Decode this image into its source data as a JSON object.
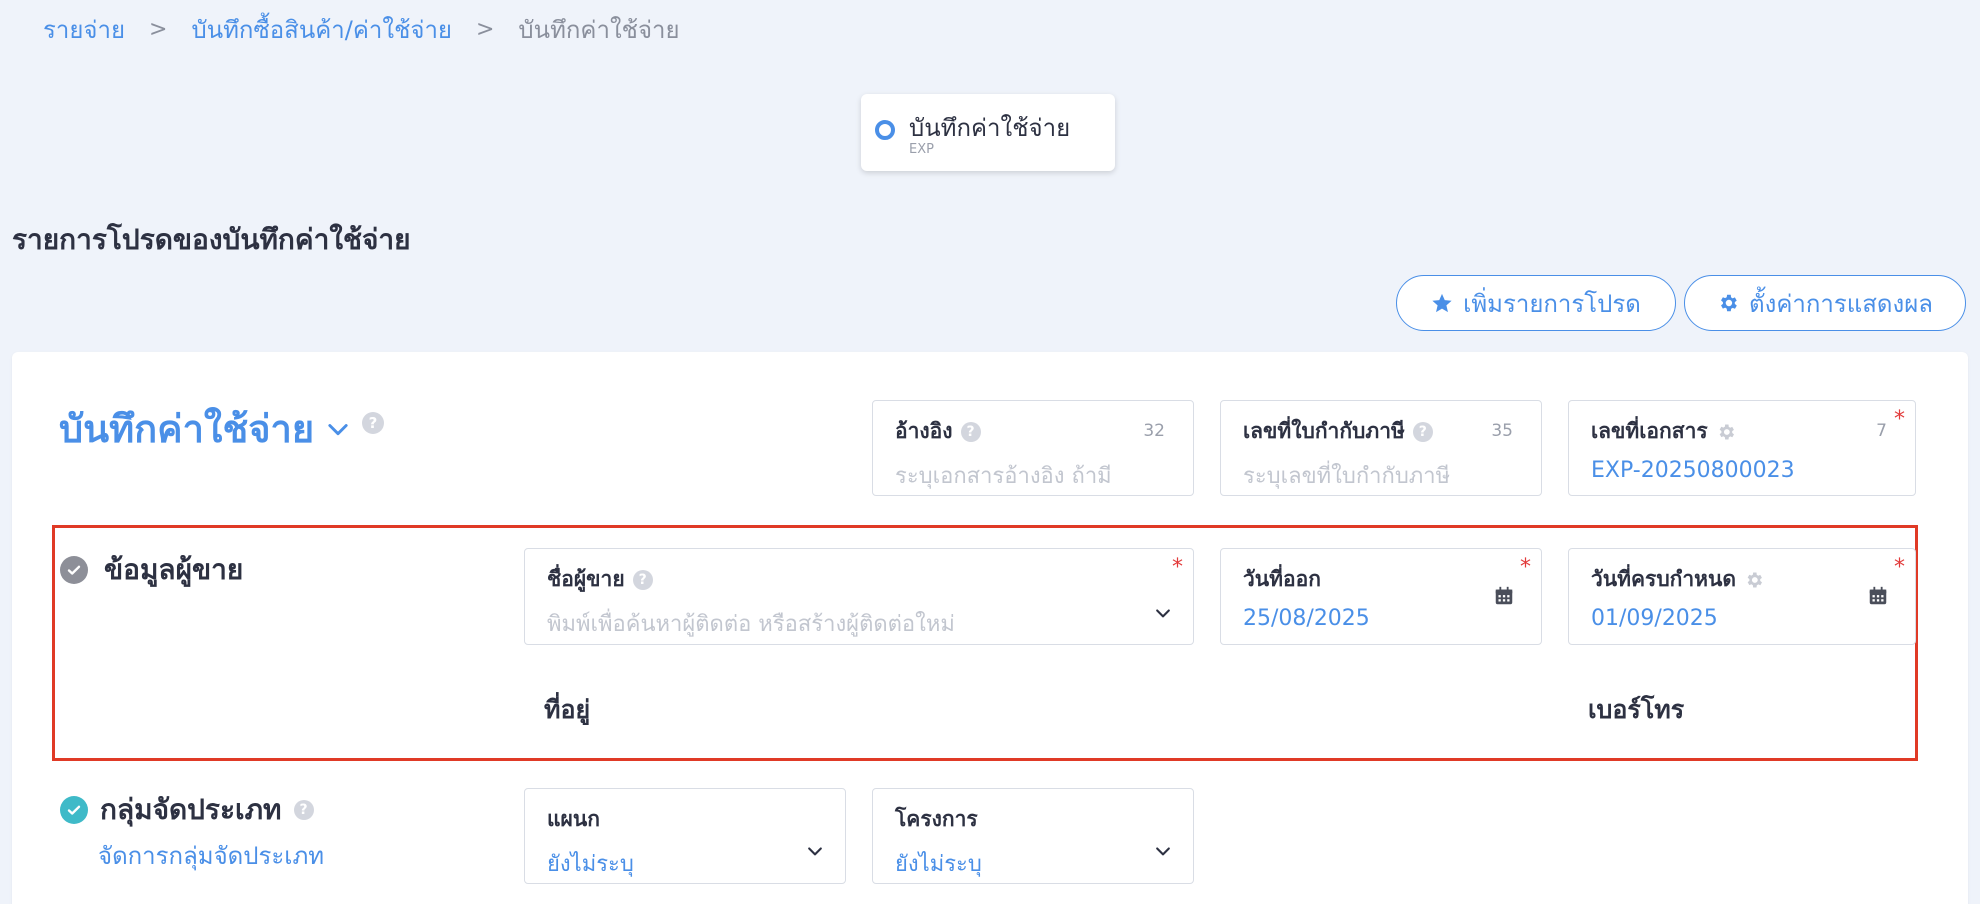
{
  "breadcrumb": {
    "items": [
      "รายจ่าย",
      "บันทึกซื้อสินค้า/ค่าใช้จ่าย"
    ],
    "separator": ">",
    "current": "บันทึกค่าใช้จ่าย"
  },
  "doc_type": {
    "title": "บันทึกค่าใช้จ่าย",
    "code": "EXP"
  },
  "favorites": {
    "heading": "รายการโปรดของบันทึกค่าใช้จ่าย",
    "add_favorite_label": "เพิ่มรายการโปรด",
    "display_settings_label": "ตั้งค่าการแสดงผล"
  },
  "document": {
    "title": "บันทึกค่าใช้จ่าย",
    "help": "?",
    "fields": {
      "reference": {
        "label": "อ้างอิง",
        "counter": "32",
        "placeholder": "ระบุเอกสารอ้างอิง ถ้ามี"
      },
      "tax_invoice": {
        "label": "เลขที่ใบกำกับภาษี",
        "counter": "35",
        "placeholder": "ระบุเลขที่ใบกำกับภาษี"
      },
      "doc_number": {
        "label": "เลขที่เอกสาร",
        "counter": "7",
        "value": "EXP-20250800023",
        "required": "*"
      }
    }
  },
  "vendor_section": {
    "title": "ข้อมูลผู้ขาย",
    "vendor_name": {
      "label": "ชื่อผู้ขาย",
      "placeholder": "พิมพ์เพื่อค้นหาผู้ติดต่อ หรือสร้างผู้ติดต่อใหม่",
      "required": "*"
    },
    "issue_date": {
      "label": "วันที่ออก",
      "value": "25/08/2025",
      "required": "*"
    },
    "due_date": {
      "label": "วันที่ครบกำหนด",
      "value": "01/09/2025",
      "required": "*"
    },
    "address_label": "ที่อยู่",
    "phone_label": "เบอร์โทร"
  },
  "category_section": {
    "title": "กลุ่มจัดประเภท",
    "manage_link": "จัดการกลุ่มจัดประเภท",
    "department": {
      "label": "แผนก",
      "value": "ยังไม่ระบุ"
    },
    "project": {
      "label": "โครงการ",
      "value": "ยังไม่ระบุ"
    }
  },
  "colors": {
    "accent": "#4a8fe7",
    "highlight": "#e03a26",
    "required": "#e23b3b",
    "teal": "#3fbac8"
  }
}
